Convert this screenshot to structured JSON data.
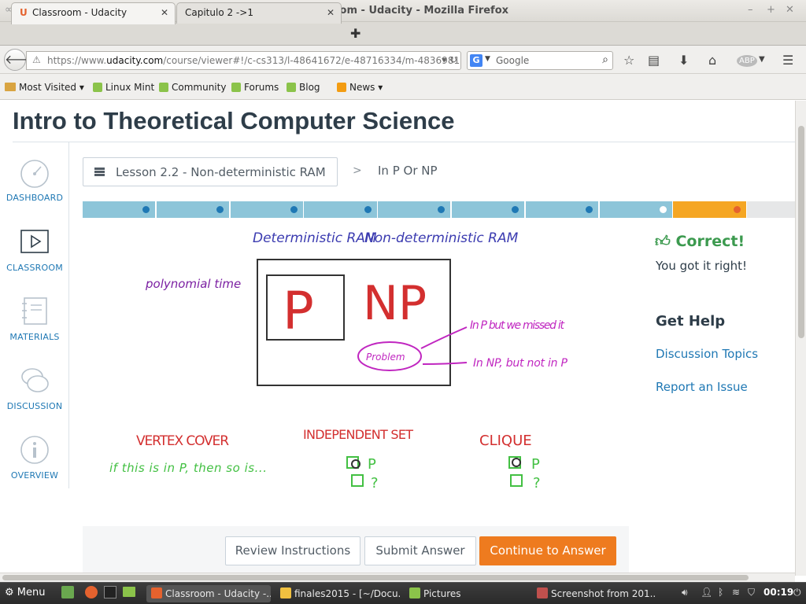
{
  "window": {
    "title": "Classroom - Udacity - Mozilla Firefox"
  },
  "tabs": [
    {
      "label": "Classroom - Udacity",
      "active": true
    },
    {
      "label": "Capitulo 2 ->1",
      "active": false
    }
  ],
  "urlbar": {
    "prefix": "https://www.",
    "domain": "udacity.com",
    "rest": "/course/viewer#!/c-cs313/l-48641672/e-48716334/m-4836981…"
  },
  "search": {
    "engine_letter": "G",
    "placeholder": "Google"
  },
  "bookmarks": [
    {
      "label": "Most Visited",
      "icon": "folder-icon",
      "dropdown": true
    },
    {
      "label": "Linux Mint",
      "icon": "mint-icon"
    },
    {
      "label": "Community",
      "icon": "mint-icon"
    },
    {
      "label": "Forums",
      "icon": "mint-icon"
    },
    {
      "label": "Blog",
      "icon": "mint-icon"
    },
    {
      "label": "News",
      "icon": "rss-icon",
      "dropdown": true
    }
  ],
  "course": {
    "title": "Intro to Theoretical Computer Science"
  },
  "sidebar": {
    "items": [
      {
        "label": "DASHBOARD",
        "icon": "gauge-icon"
      },
      {
        "label": "CLASSROOM",
        "icon": "play-icon"
      },
      {
        "label": "MATERIALS",
        "icon": "notebook-icon"
      },
      {
        "label": "DISCUSSION",
        "icon": "chat-bubbles-icon"
      },
      {
        "label": "OVERVIEW",
        "icon": "info-icon"
      }
    ]
  },
  "breadcrumb": {
    "lesson": "Lesson 2.2 - Non-deterministic RAM",
    "separator": ">",
    "current": "In P Or NP"
  },
  "progress": {
    "segments": [
      {
        "state": "done"
      },
      {
        "state": "done"
      },
      {
        "state": "done"
      },
      {
        "state": "done"
      },
      {
        "state": "done"
      },
      {
        "state": "done"
      },
      {
        "state": "done"
      },
      {
        "state": "current-white"
      },
      {
        "state": "active"
      },
      {
        "state": "upcoming"
      }
    ],
    "colors": {
      "done": "#8dc5d9",
      "active": "#f5a623",
      "upcoming": "#e6e7e8",
      "dot": "#1f78b4",
      "active_dot": "#e5622e"
    }
  },
  "video": {
    "heading_deterministic": "Deterministic RAM",
    "heading_nondeterministic": "Non-deterministic RAM",
    "side_note": "polynomial time",
    "box_p": "P",
    "box_np": "NP",
    "problem_label": "Problem",
    "arrow1_text": "In P but we missed it",
    "arrow2_text": "In NP, but not in P",
    "vertex_cover": "VERTEX COVER",
    "green_note": "if this is in P, then so is...",
    "independent_set": "INDEPENDENT SET",
    "clique": "CLIQUE",
    "p_mark": "P",
    "q_mark": "?"
  },
  "feedback": {
    "title": "Correct!",
    "subtitle": "You got it right!"
  },
  "help": {
    "title": "Get Help",
    "links": [
      "Discussion Topics",
      "Report an Issue"
    ]
  },
  "actions": {
    "review": "Review Instructions",
    "submit": "Submit Answer",
    "continue": "Continue to Answer"
  },
  "taskbar": {
    "menu": "Menu",
    "tasks": [
      {
        "label": "Classroom - Udacity -...",
        "active": true,
        "color": "#e5622e"
      },
      {
        "label": "finales2015 - [~/Docu...",
        "active": false,
        "color": "#f0c040"
      },
      {
        "label": "Pictures",
        "active": false,
        "color": "#8bc34a"
      },
      {
        "label": "Screenshot from 201...",
        "active": false,
        "color": "#c0504d"
      }
    ],
    "clock": "00:19"
  }
}
